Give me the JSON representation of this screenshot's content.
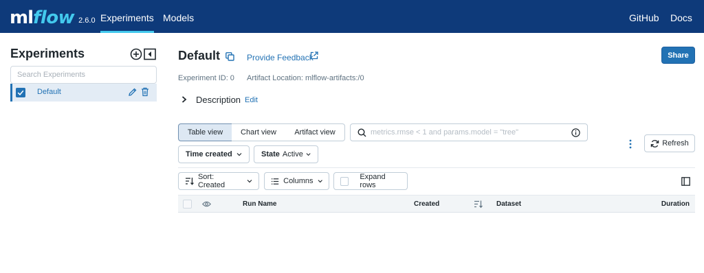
{
  "brand": {
    "logo_ml": "ml",
    "logo_flow": "flow",
    "version": "2.6.0",
    "accent": "#43c9ed",
    "nav_bg": "#0e3a7a"
  },
  "nav": {
    "experiments": "Experiments",
    "models": "Models",
    "github": "GitHub",
    "docs": "Docs"
  },
  "sidebar": {
    "title": "Experiments",
    "search_placeholder": "Search Experiments",
    "experiments": [
      {
        "name": "Default",
        "checked": true
      }
    ],
    "icons": [
      "add-icon",
      "collapse-icon",
      "edit-icon",
      "trash-icon"
    ]
  },
  "header": {
    "title": "Default",
    "feedback": "Provide Feedback",
    "share": "Share",
    "experiment_id": "Experiment ID: 0",
    "artifact_location": "Artifact Location: mlflow-artifacts:/0",
    "description": "Description",
    "description_edit": "Edit"
  },
  "views": {
    "table": "Table view",
    "chart": "Chart view",
    "artifact": "Artifact view",
    "selected": "Table view"
  },
  "search": {
    "placeholder": "metrics.rmse < 1 and params.model = \"tree\""
  },
  "actions": {
    "refresh": "Refresh"
  },
  "filters": {
    "time": "Time created",
    "state_label": "State",
    "state_value": "Active"
  },
  "toolbar": {
    "sort": "Sort: Created",
    "columns": "Columns",
    "expand_rows": "Expand rows"
  },
  "table": {
    "columns": [
      "Run Name",
      "Created",
      "Dataset",
      "Duration"
    ]
  },
  "colors": {
    "primary": "#2272b4",
    "selected_row": "#e3ecf5"
  }
}
